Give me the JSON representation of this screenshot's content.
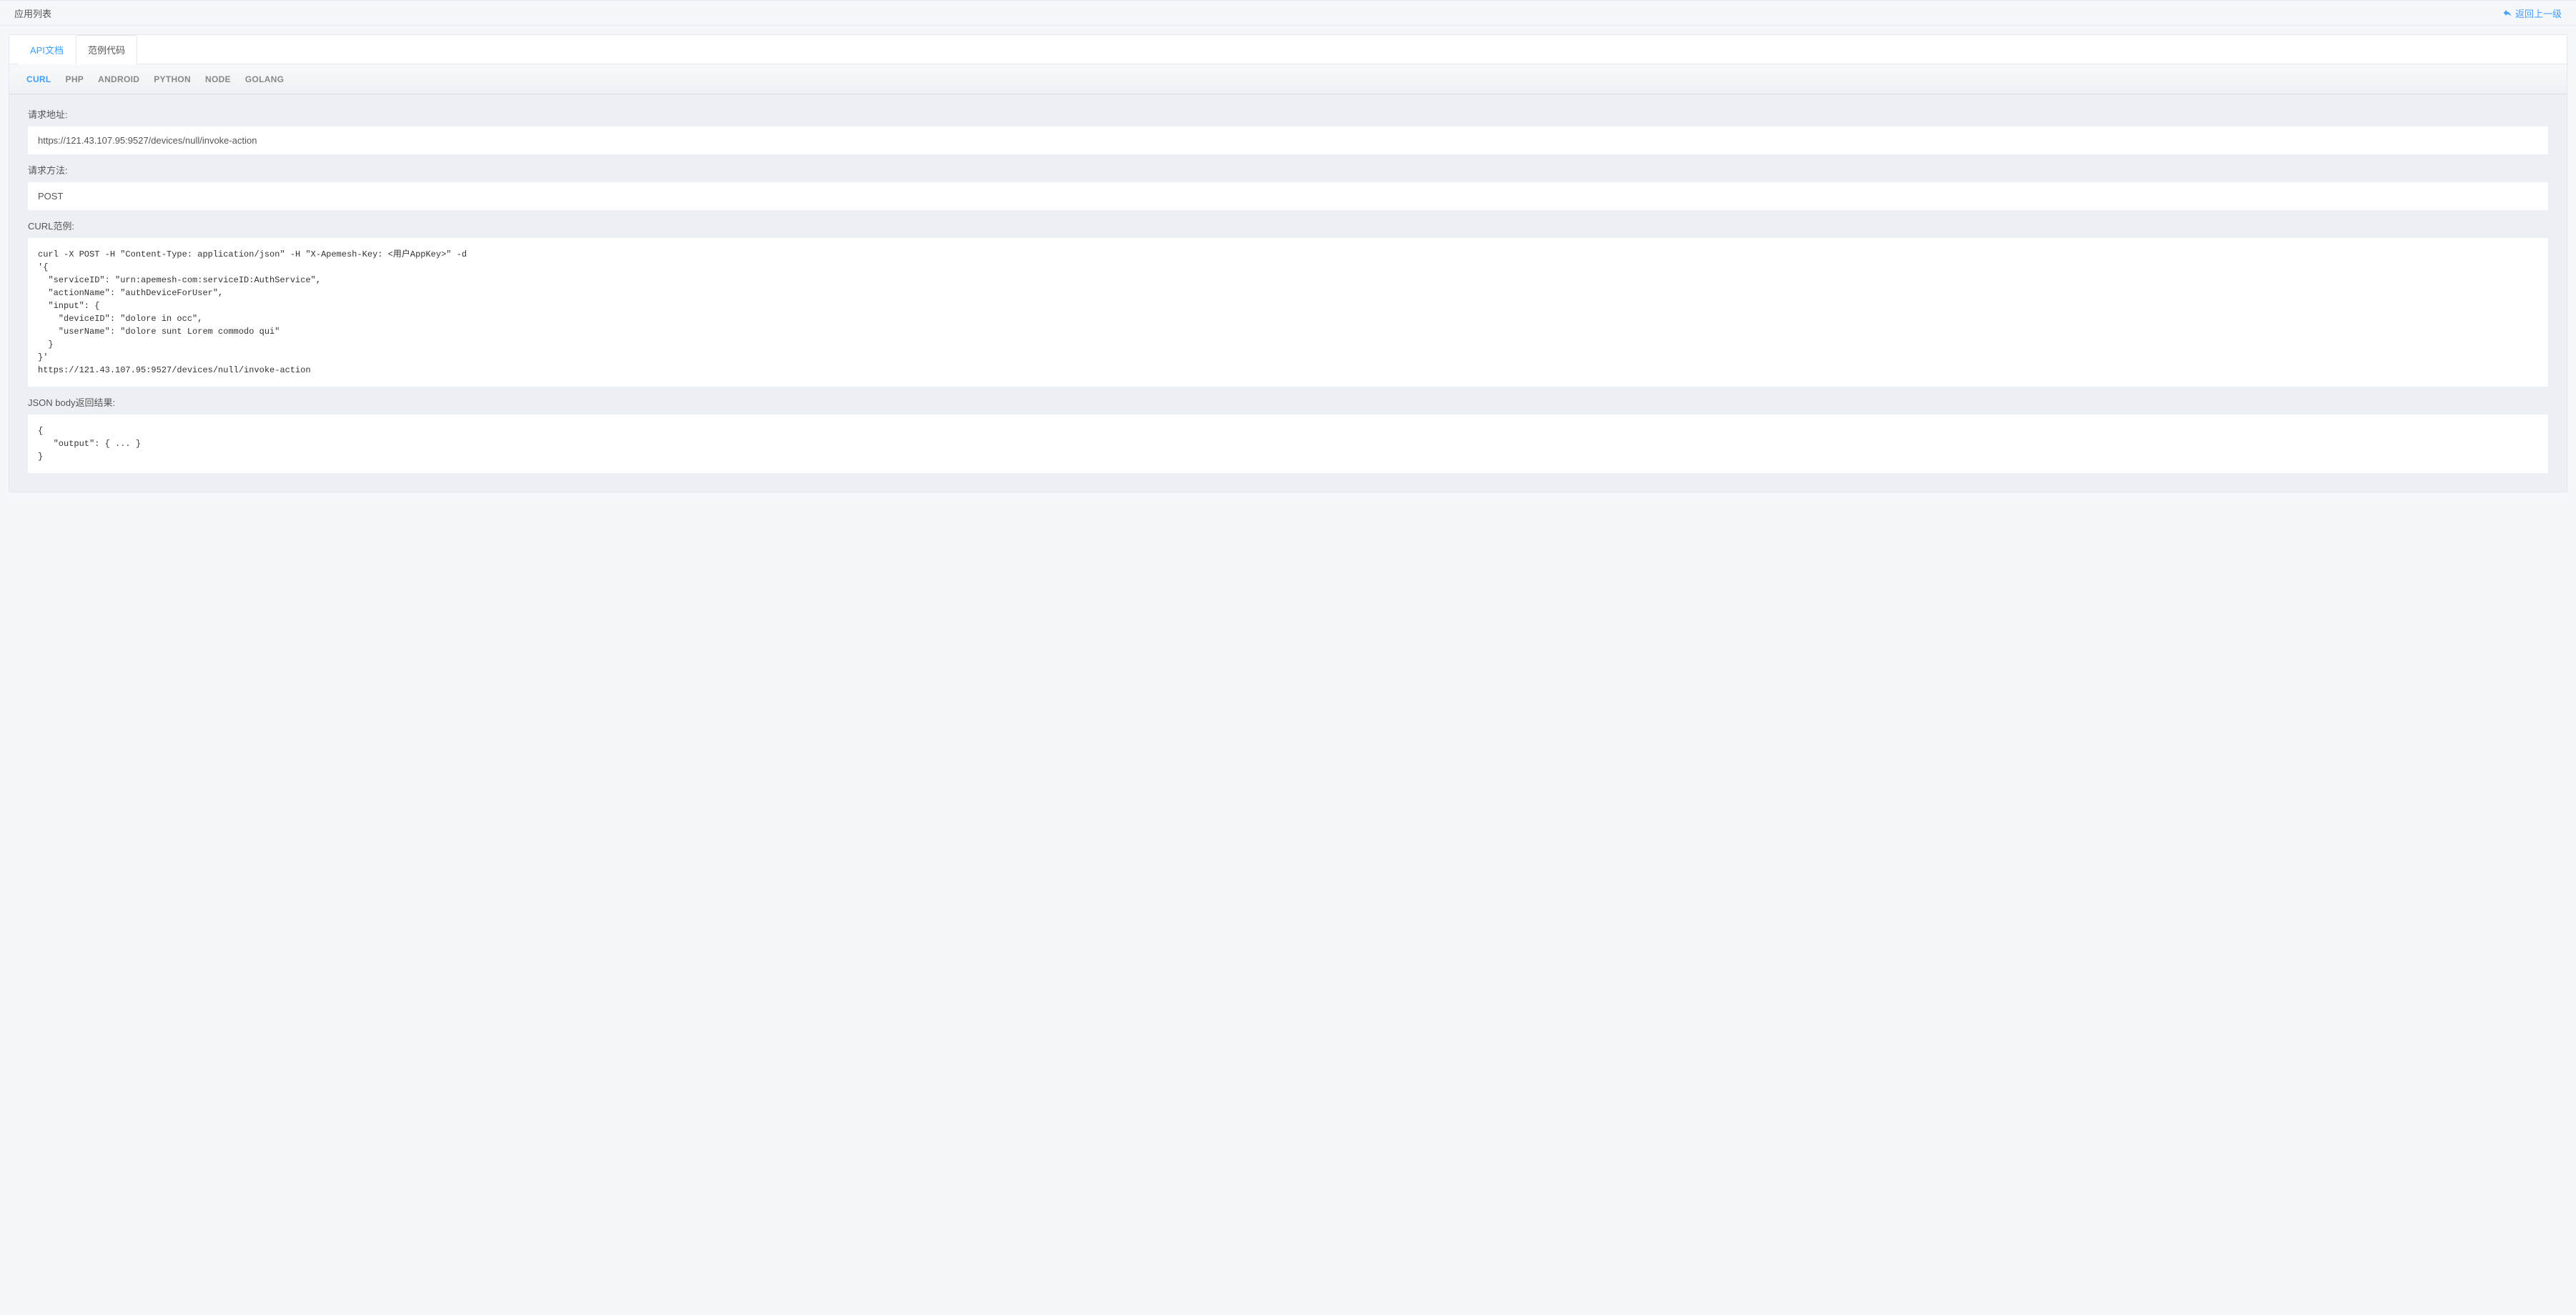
{
  "header": {
    "title": "应用列表",
    "back_label": "返回上一级"
  },
  "tabs": {
    "api_doc": "API文档",
    "sample_code": "范例代码"
  },
  "lang_tabs": {
    "curl": "CURL",
    "php": "PHP",
    "android": "ANDROID",
    "python": "PYTHON",
    "node": "NODE",
    "golang": "GOLANG"
  },
  "sections": {
    "request_url_label": "请求地址:",
    "request_url_value": "https://121.43.107.95:9527/devices/null/invoke-action",
    "request_method_label": "请求方法:",
    "request_method_value": "POST",
    "curl_example_label": "CURL范例:",
    "curl_example_value": "curl -X POST -H \"Content-Type: application/json\" -H \"X-Apemesh-Key: <用户AppKey>\" -d\n'{\n  \"serviceID\": \"urn:apemesh-com:serviceID:AuthService\",\n  \"actionName\": \"authDeviceForUser\",\n  \"input\": {\n    \"deviceID\": \"dolore in occ\",\n    \"userName\": \"dolore sunt Lorem commodo qui\"\n  }\n}'\nhttps://121.43.107.95:9527/devices/null/invoke-action",
    "json_body_label": "JSON body返回结果:",
    "json_body_value": "{\n   \"output\": { ... }\n}"
  }
}
